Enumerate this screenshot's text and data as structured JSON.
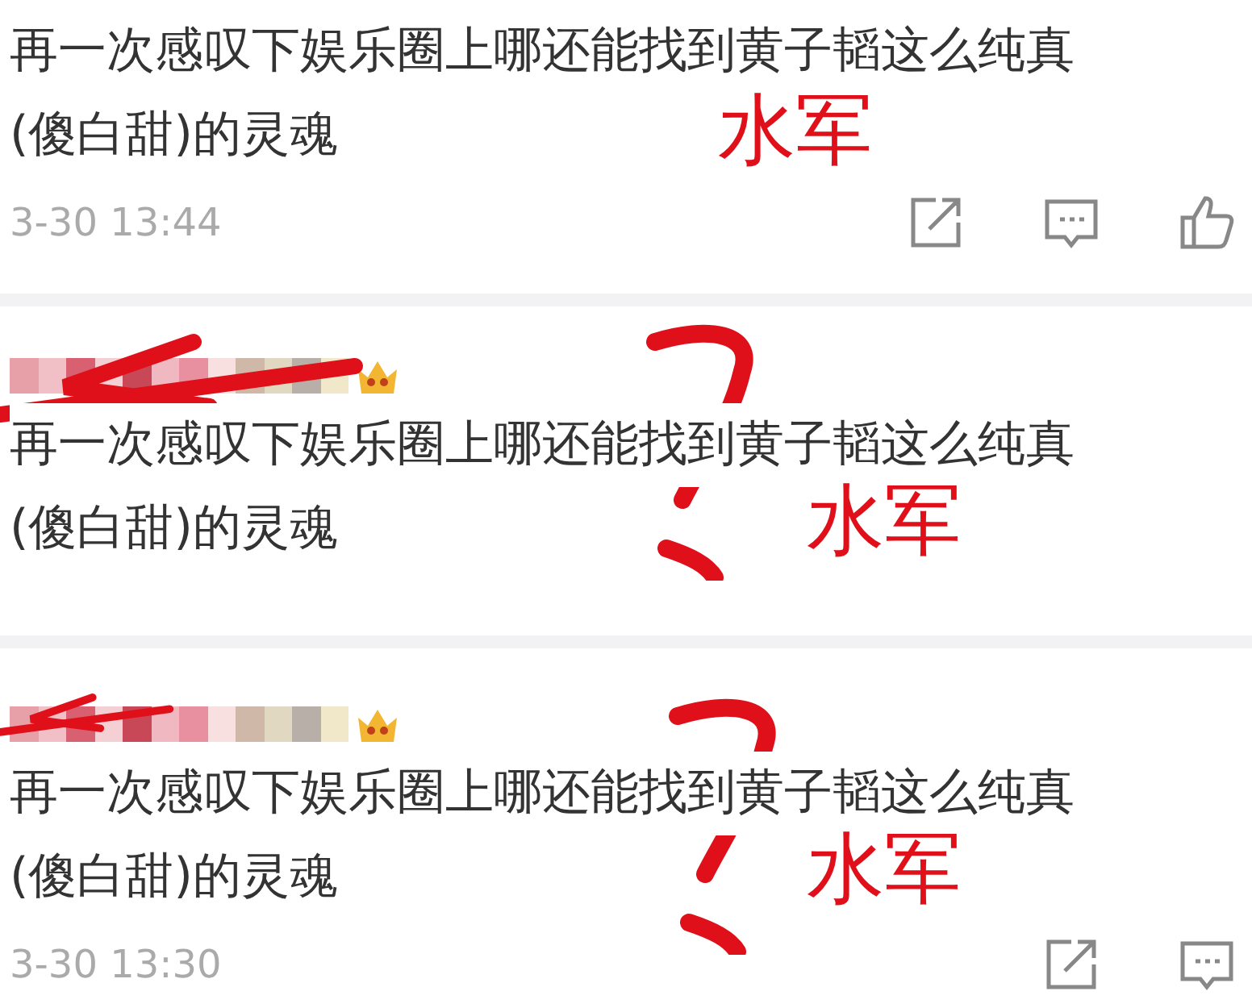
{
  "comments": [
    {
      "lines": [
        "再一次感叹下娱乐圈上哪还能找到黄子韬这么纯真",
        "(傻白甜)的灵魂"
      ],
      "time": "3-30 13:44",
      "actions": [
        {
          "kind": "share"
        },
        {
          "kind": "comment"
        },
        {
          "kind": "like"
        }
      ],
      "annotation": {
        "text": "水军",
        "question_mark": false,
        "arrow": false
      }
    },
    {
      "author": {
        "badge": true
      },
      "lines": [
        "再一次感叹下娱乐圈上哪还能找到黄子韬这么纯真",
        "(傻白甜)的灵魂"
      ],
      "annotation": {
        "text": "水军",
        "question_mark": true,
        "arrow": true
      }
    },
    {
      "author": {
        "badge": true
      },
      "lines": [
        "再一次感叹下娱乐圈上哪还能找到黄子韬这么纯真",
        "(傻白甜)的灵魂"
      ],
      "time": "3-30 13:30",
      "actions": [
        {
          "kind": "share"
        },
        {
          "kind": "comment"
        }
      ],
      "annotation": {
        "text": "水军",
        "question_mark": true,
        "arrow": true
      }
    }
  ]
}
